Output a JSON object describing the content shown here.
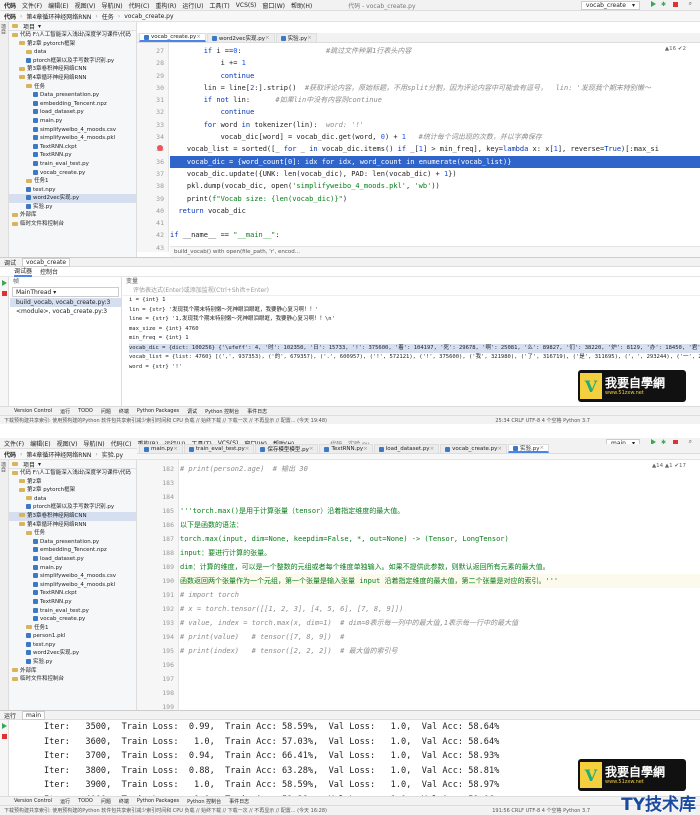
{
  "top": {
    "menu": [
      "代码",
      "第4章循环神经网络RNN",
      "任务",
      "vocab_create.py",
      "文件(F)",
      "编辑(E)",
      "视图(V)",
      "导航(N)",
      "代码(C)",
      "重构(R)",
      "运行(U)",
      "工具(T)",
      "VCS(S)",
      "窗口(W)",
      "帮助(H)"
    ],
    "window_title": "代码 - vocab_create.py",
    "run_config": "vocab_create",
    "breadcrumbs": [
      "代码",
      "第4章循环神经网络RNN",
      "任务",
      "vocab_create.py"
    ],
    "project_label": "项目",
    "tree": [
      {
        "label": "代码 F:\\人工智能深入浅出\\深度学习课件\\代码",
        "type": "folder",
        "depth": 0
      },
      {
        "label": "第2章 pytorch框架",
        "type": "folder",
        "depth": 1
      },
      {
        "label": "data",
        "type": "folder",
        "depth": 2
      },
      {
        "label": "ptorch框架以及手写数字识别.py",
        "type": "file",
        "depth": 2
      },
      {
        "label": "第3章卷积神经网络CNN",
        "type": "folder",
        "depth": 1
      },
      {
        "label": "第4章循环神经网络RNN",
        "type": "folder",
        "depth": 1
      },
      {
        "label": "任务",
        "type": "folder",
        "depth": 2
      },
      {
        "label": "Data_presentation.py",
        "type": "file",
        "depth": 3
      },
      {
        "label": "embedding_Tencent.npz",
        "type": "file",
        "depth": 3
      },
      {
        "label": "load_dataset.py",
        "type": "file",
        "depth": 3
      },
      {
        "label": "main.py",
        "type": "file",
        "depth": 3
      },
      {
        "label": "simplifyweibo_4_moods.csv",
        "type": "file",
        "depth": 3
      },
      {
        "label": "simplifyweibo_4_moods.pkl",
        "type": "file",
        "depth": 3
      },
      {
        "label": "TextRNN.ckpt",
        "type": "file",
        "depth": 3
      },
      {
        "label": "TextRNN.py",
        "type": "file",
        "depth": 3
      },
      {
        "label": "train_eval_test.py",
        "type": "file",
        "depth": 3
      },
      {
        "label": "vocab_create.py",
        "type": "file",
        "depth": 3
      },
      {
        "label": "任务1",
        "type": "folder",
        "depth": 2
      },
      {
        "label": "test.npy",
        "type": "file",
        "depth": 2
      },
      {
        "label": "word2vec实现.py",
        "type": "file",
        "depth": 2,
        "selected": true
      },
      {
        "label": "实验.py",
        "type": "file",
        "depth": 2
      },
      {
        "label": "外部库",
        "type": "folder",
        "depth": 0
      },
      {
        "label": "临时文件和控制台",
        "type": "folder",
        "depth": 0
      }
    ],
    "tabs": [
      {
        "label": "vocab_create.py",
        "active": true
      },
      {
        "label": "word2vec实现.py",
        "active": false
      },
      {
        "label": "实验.py",
        "active": false
      }
    ],
    "editor_status": "▲16 ✔2",
    "line_numbers": [
      "27",
      "28",
      "29",
      "30",
      "31",
      "32",
      "33",
      "34",
      "35",
      "36",
      "37",
      "38",
      "39",
      "40",
      "41",
      "42",
      "43"
    ],
    "editor_breadcrumb": "build_vocab()    with open(file_path, 'r', encod...",
    "debug_tab": "vocab_create",
    "debug_label": "调试",
    "debugger_tab": "调试器",
    "console_tab": "控制台",
    "frames_label": "帧",
    "vars_label": "变量",
    "thread": "MainThread",
    "frames": [
      "build_vocab, vocab_create.py:3",
      "<module>, vocab_create.py:3"
    ],
    "eval_placeholder": "评估表达式(Enter)或添加监视(Ctrl+Shift+Enter)",
    "vars": [
      "i = {int} 1",
      "lin = {str} '发现我个期末特别懒～死神眼泪眼眶，我要静心复习啊！！'",
      "line = {str} '1,发现我个期末特别懒～死神眼泪眼眶，我要静心复习啊！！\\n'",
      "max_size = {int} 4760",
      "min_freq = {int} 1",
      "vocab_dic = {dict: 100256} {'\\ufeff': 4, '时': 102350, '日': 15733, '!': 375600, '着': 104197, '死': 29678, '啊': 25081, '么': 89827, '们': 38220, '炉': 8129, '办': 18450, '君': 4885}",
      "vocab_list = {list: 4760} [(',', 937353), ('的', 679357), ('.', 600957), ('!', 572121), ('!', 375600), ('我', 321980), ('了', 316719), ('是', 311695), ('，', 293244), ('一', 285746)]",
      "word = {str} '!'"
    ],
    "status": "下载预构建共享索引: 使用预构建的Python 软件包共享索引减少索引时间和 CPU 负载 // 始终下载 // 下载一次 // 不再显示 // 配置... (今天 19:48)",
    "status_right": "25:34  CRLF  UTF-8  4 个空格  Python 3.7",
    "bottom_tabs": [
      "Version Control",
      "运行",
      "TODO",
      "问题",
      "终端",
      "Python Packages",
      "调试",
      "Python 控制台",
      "事件日志"
    ]
  },
  "bottom": {
    "menu": [
      "文件(F)",
      "编辑(E)",
      "视图(V)",
      "导航(N)",
      "代码(C)",
      "重构(R)",
      "运行(U)",
      "工具(T)",
      "VCS(S)",
      "窗口(W)",
      "帮助(H)"
    ],
    "window_title": "代码 - 实验.py",
    "run_config": "main",
    "breadcrumbs": [
      "代码",
      "第4章循环神经网络RNN",
      "实验.py"
    ],
    "project_label": "项目",
    "tree": [
      {
        "label": "代码 F:\\人工智能深入浅出\\深度学习课件\\代码",
        "type": "folder",
        "depth": 0
      },
      {
        "label": "第2章",
        "type": "folder",
        "depth": 1
      },
      {
        "label": "第2章 pytorch框架",
        "type": "folder",
        "depth": 1
      },
      {
        "label": "data",
        "type": "folder",
        "depth": 2
      },
      {
        "label": "ptorch框架以及手写数字识别.py",
        "type": "file",
        "depth": 2
      },
      {
        "label": "第3章卷积神经网络CNN",
        "type": "folder",
        "depth": 1,
        "selected": true
      },
      {
        "label": "第4章循环神经网络RNN",
        "type": "folder",
        "depth": 1
      },
      {
        "label": "任务",
        "type": "folder",
        "depth": 2
      },
      {
        "label": "Data_presentation.py",
        "type": "file",
        "depth": 3
      },
      {
        "label": "embedding_Tencent.npz",
        "type": "file",
        "depth": 3
      },
      {
        "label": "load_dataset.py",
        "type": "file",
        "depth": 3
      },
      {
        "label": "main.py",
        "type": "file",
        "depth": 3
      },
      {
        "label": "simplifyweibo_4_moods.csv",
        "type": "file",
        "depth": 3
      },
      {
        "label": "simplifyweibo_4_moods.pkl",
        "type": "file",
        "depth": 3
      },
      {
        "label": "TextRNN.ckpt",
        "type": "file",
        "depth": 3
      },
      {
        "label": "TextRNN.py",
        "type": "file",
        "depth": 3
      },
      {
        "label": "train_eval_test.py",
        "type": "file",
        "depth": 3
      },
      {
        "label": "vocab_create.py",
        "type": "file",
        "depth": 3
      },
      {
        "label": "任务1",
        "type": "folder",
        "depth": 2
      },
      {
        "label": "person1.pkl",
        "type": "file",
        "depth": 2
      },
      {
        "label": "test.npy",
        "type": "file",
        "depth": 2
      },
      {
        "label": "word2vec实现.py",
        "type": "file",
        "depth": 2
      },
      {
        "label": "实验.py",
        "type": "file",
        "depth": 2
      },
      {
        "label": "外部库",
        "type": "folder",
        "depth": 0
      },
      {
        "label": "临时文件和控制台",
        "type": "folder",
        "depth": 0
      }
    ],
    "tabs": [
      {
        "label": "main.py",
        "active": false
      },
      {
        "label": "train_eval_test.py",
        "active": false
      },
      {
        "label": "保存模型模型.py",
        "active": false
      },
      {
        "label": "TextRNN.py",
        "active": false
      },
      {
        "label": "load_dataset.py",
        "active": false
      },
      {
        "label": "vocab_create.py",
        "active": false
      },
      {
        "label": "实验.py",
        "active": true
      }
    ],
    "editor_status": "▲14 ▲1 ✔17",
    "line_numbers": [
      "182",
      "183",
      "184",
      "185",
      "186",
      "187",
      "188",
      "189",
      "190",
      "191",
      "192",
      "193",
      "194",
      "195",
      "196",
      "197",
      "198",
      "199"
    ],
    "run_label": "运行",
    "run_tab": "main",
    "log": [
      "Iter:   3500,  Train Loss:  0.99,  Train Acc: 58.59%,  Val Loss:   1.0,  Val Acc: 58.64%",
      "Iter:   3600,  Train Loss:   1.0,  Train Acc: 57.03%,  Val Loss:   1.0,  Val Acc: 58.64%",
      "Iter:   3700,  Train Loss:  0.94,  Train Acc: 66.41%,  Val Loss:   1.0,  Val Acc: 58.93%",
      "Iter:   3800,  Train Loss:  0.88,  Train Acc: 63.28%,  Val Loss:   1.0,  Val Acc: 58.81%",
      "Iter:   3900,  Train Loss:   1.0,  Train Acc: 58.59%,  Val Loss:   1.0,  Val Acc: 58.97%",
      "Iter:   4000,  Train Loss:   1.0,  Train Acc: 59.38%,  Val Loss:   1.0,  Val Acc: 59.06%"
    ],
    "status": "下载预构建共享索引: 使用预构建的Python 软件包共享索引减少索引时间和 CPU 负载 // 始终下载 // 下载一次 // 不再显示 // 配置... (今天 16:28)",
    "status_right": "191:56  CRLF  UTF-8  4 个空格  Python 3.7",
    "bottom_tabs": [
      "Version Control",
      "运行",
      "TODO",
      "问题",
      "终端",
      "Python Packages",
      "Python 控制台",
      "事件日志"
    ]
  },
  "watermark": {
    "title": "我要自學網",
    "url": "www.51zxw.net",
    "corner": "TY技术库"
  }
}
